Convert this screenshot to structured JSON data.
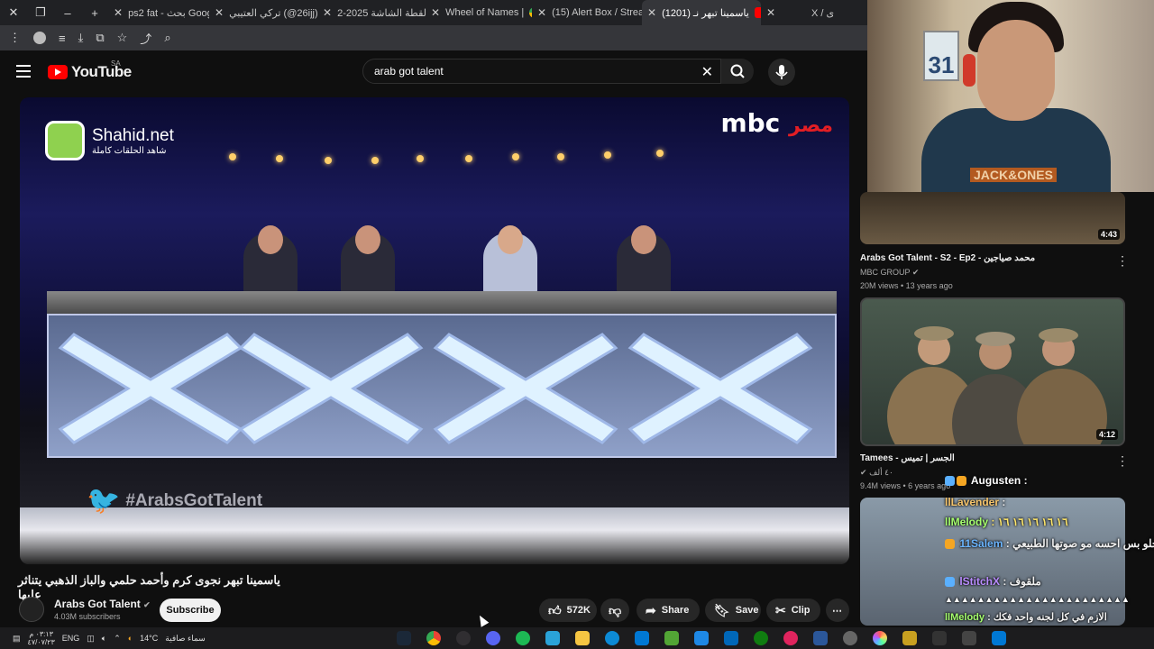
{
  "browser": {
    "tabs": [
      {
        "title": "ps2 fat - بحث Google",
        "color": "#4285f4"
      },
      {
        "title": "تركي العتيبي (@26ijj)",
        "color": "#000000"
      },
      {
        "title": "لقطة الشاشة 2025-2",
        "color": "#7a7a7a"
      },
      {
        "title": "Wheel of Names |",
        "color": "#e8453c"
      },
      {
        "title": "(15) Alert Box / Strea",
        "color": "#53fc18"
      },
      {
        "title": "(1201) ياسمينا تبهر نـ",
        "color": "#ff0000",
        "active": true
      },
      {
        "title": "X / ی",
        "color": "#ffffff"
      }
    ],
    "new_tab": "+",
    "close_symbol": "✕"
  },
  "youtube": {
    "logo_text": "YouTube",
    "country": "SA",
    "search_value": "arab got talent",
    "clear_symbol": "✕"
  },
  "video": {
    "shahid_name": "Shahid.net",
    "shahid_tagline": "شاهد الحلقات كاملة",
    "mbc_text": "mbc",
    "mbc_masr": "مصر",
    "hashtag": "#ArabsGotTalent",
    "title": "ياسمينا تبهر نجوى كرم وأحمد حلمي والباز الذهبي يتناثر عليها",
    "channel_name": "Arabs Got Talent",
    "subscribers": "4.03M subscribers",
    "subscribe_label": "Subscribe",
    "likes": "572K",
    "share_label": "Share",
    "save_label": "Save",
    "clip_label": "Clip",
    "more_label": "⋯"
  },
  "recommendations": [
    {
      "duration": "4:43",
      "title": "Arabs Got Talent - S2 - Ep2 - محمد صياجين",
      "channel": "MBC GROUP",
      "meta": "20M views • 13 years ago"
    },
    {
      "duration": "4:12",
      "title": "Tamees - الجسر | تميس",
      "channel": "٤٠ ألف",
      "meta": "9.4M views • 6 years ago"
    }
  ],
  "webcam": {
    "calendar_number": "31",
    "shirt_logo": "JACK&ONES"
  },
  "chat": [
    {
      "user": "Augusten",
      "message": ":",
      "color": "#ffffff"
    },
    {
      "user": "llLavender",
      "message": ":",
      "color": "#f5c46b"
    },
    {
      "user": "llMelody",
      "message": ": ١٦ ١٦ ١٦ ١٦ ١٦",
      "color": "#a6ff6e"
    },
    {
      "user": "11Salem",
      "message": ": ياخي الصوت حلو بس احسه مو صوتها الطبيعي",
      "color": "#6bb5ff"
    },
    {
      "user": "lStitchX",
      "message": ": ملقوف",
      "color": "#b98cff"
    },
    {
      "user": "",
      "message": "▲▲▲▲▲▲▲▲▲▲▲▲▲▲▲▲▲▲▲▲▲▲▲",
      "color": "#ffffff"
    },
    {
      "user": "llMelody",
      "message": ": الازم في كل لجنه واحد فكك",
      "color": "#a6ff6e"
    }
  ],
  "taskbar": {
    "language": "ENG",
    "temperature": "14°C",
    "weather": "سماء صافية",
    "time": "٠٣:١٣ م",
    "date": "٤٧/٠٧/٢٣"
  }
}
